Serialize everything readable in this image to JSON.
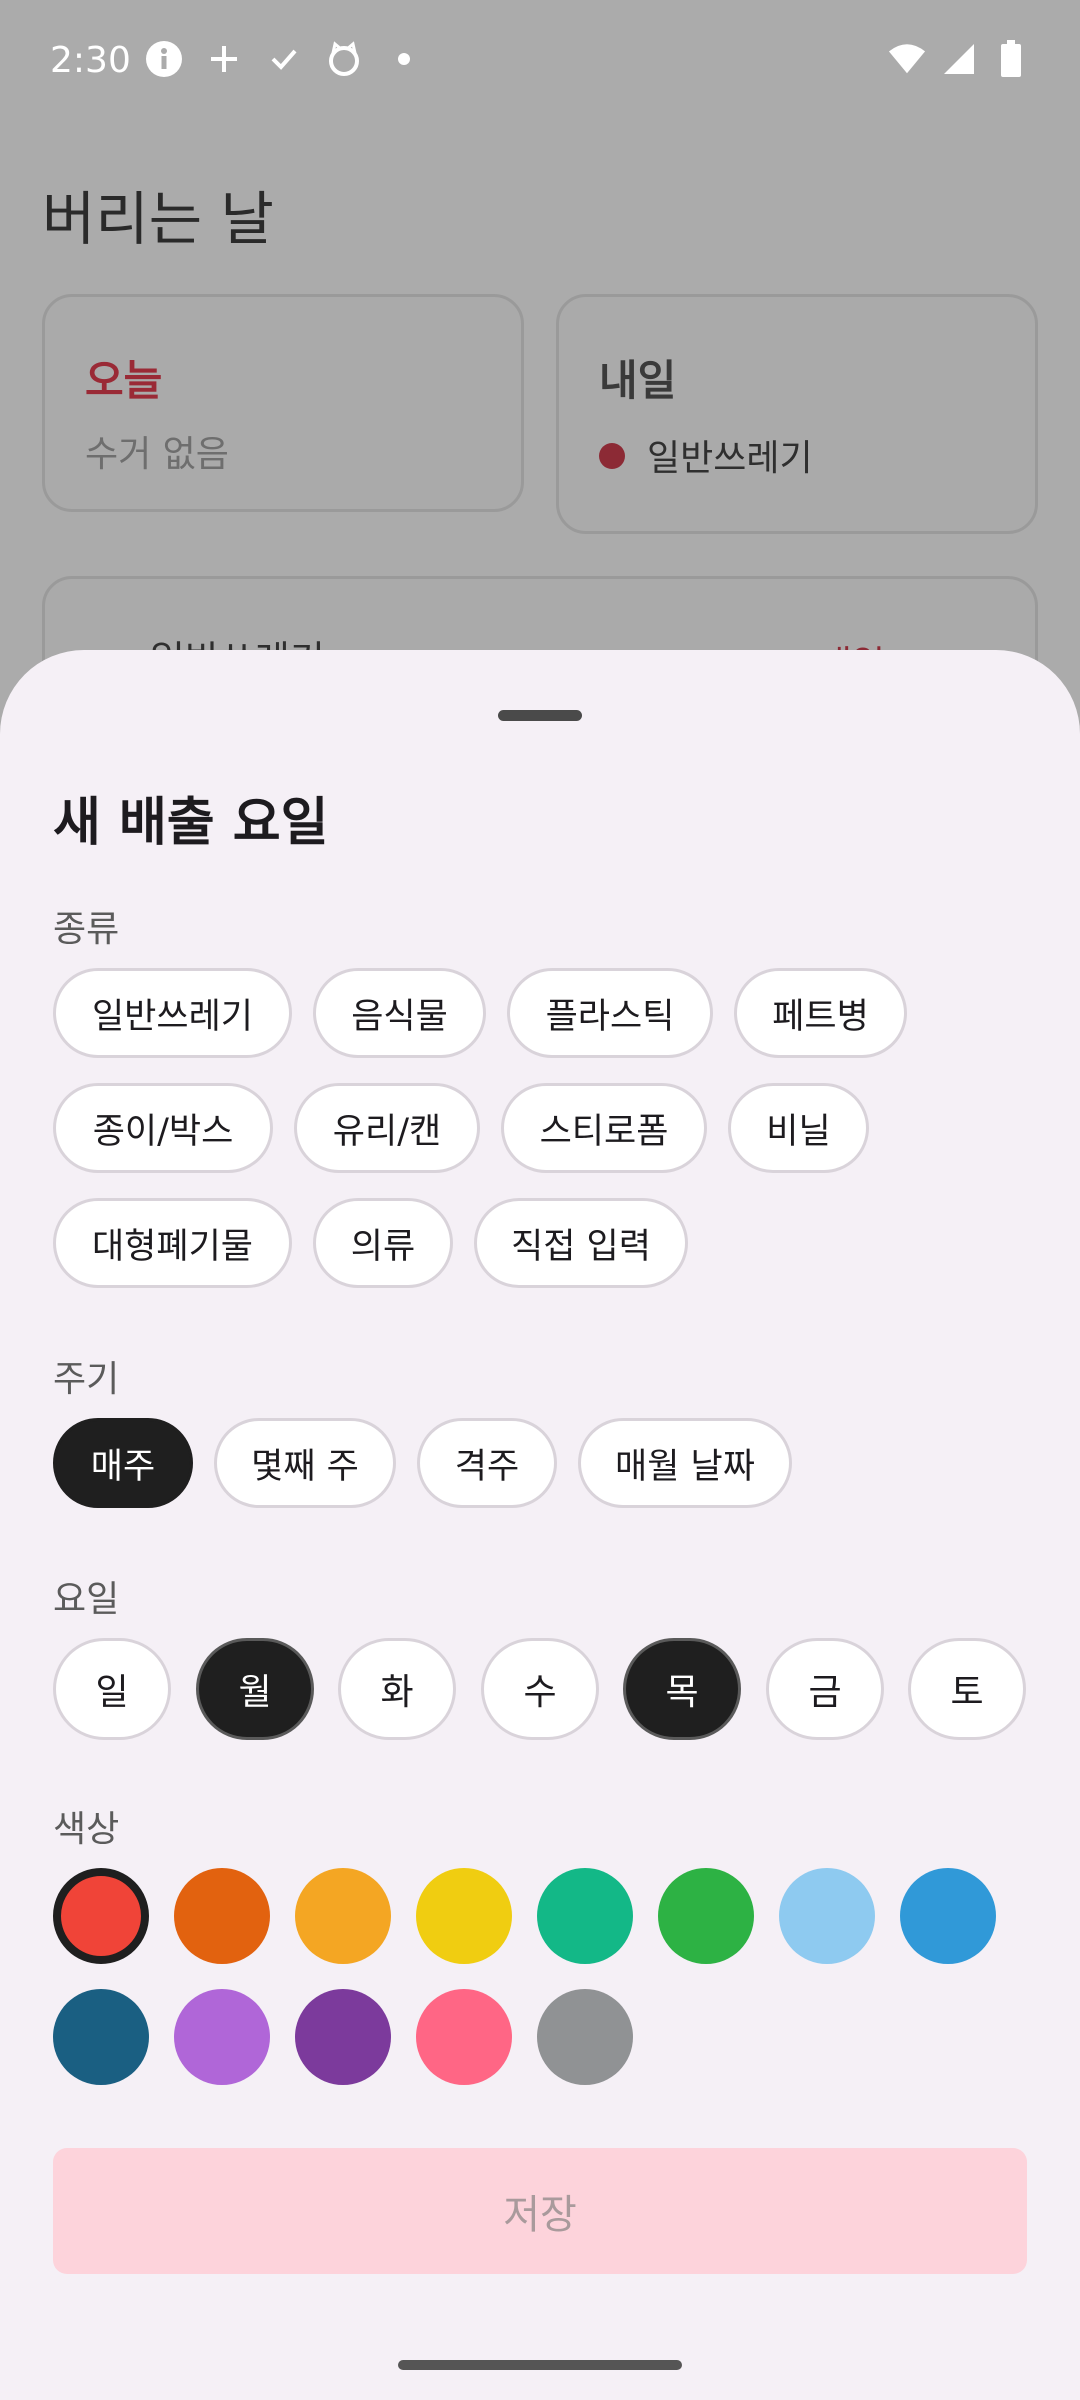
{
  "status_bar": {
    "time": "2:30",
    "icons_left": [
      "info-icon",
      "plus-icon",
      "check-icon",
      "cat-icon",
      "dot-icon"
    ],
    "icons_right": [
      "wifi-icon",
      "signal-icon",
      "battery-icon"
    ]
  },
  "background": {
    "title": "버리는 날",
    "today": {
      "title": "오늘",
      "subtitle": "수거 없음"
    },
    "tomorrow": {
      "title": "내일",
      "item": "일반쓰레기"
    },
    "list_peek": {
      "label": "일반쓰레기",
      "right": "내일"
    },
    "colors": {
      "today_title": "#9a2a36",
      "dot": "#8c2a35"
    }
  },
  "sheet": {
    "title": "새 배출 요일",
    "type_label": "종류",
    "types": [
      "일반쓰레기",
      "음식물",
      "플라스틱",
      "페트병",
      "종이/박스",
      "유리/캔",
      "스티로폼",
      "비닐",
      "대형폐기물",
      "의류",
      "직접 입력"
    ],
    "cycle_label": "주기",
    "cycles": [
      "매주",
      "몇째 주",
      "격주",
      "매월 날짜"
    ],
    "cycle_selected": "매주",
    "day_label": "요일",
    "days": [
      "일",
      "월",
      "화",
      "수",
      "목",
      "금",
      "토"
    ],
    "days_selected": [
      "월",
      "목"
    ],
    "color_label": "색상",
    "colors": [
      "#f04438",
      "#e2620f",
      "#f4a623",
      "#f0cd11",
      "#13b887",
      "#2db244",
      "#8ecaf0",
      "#3099d8",
      "#1a5f82",
      "#b066d8",
      "#7c3a9c",
      "#ff6685",
      "#909294"
    ],
    "color_selected": "#f04438",
    "save_label": "저장"
  }
}
